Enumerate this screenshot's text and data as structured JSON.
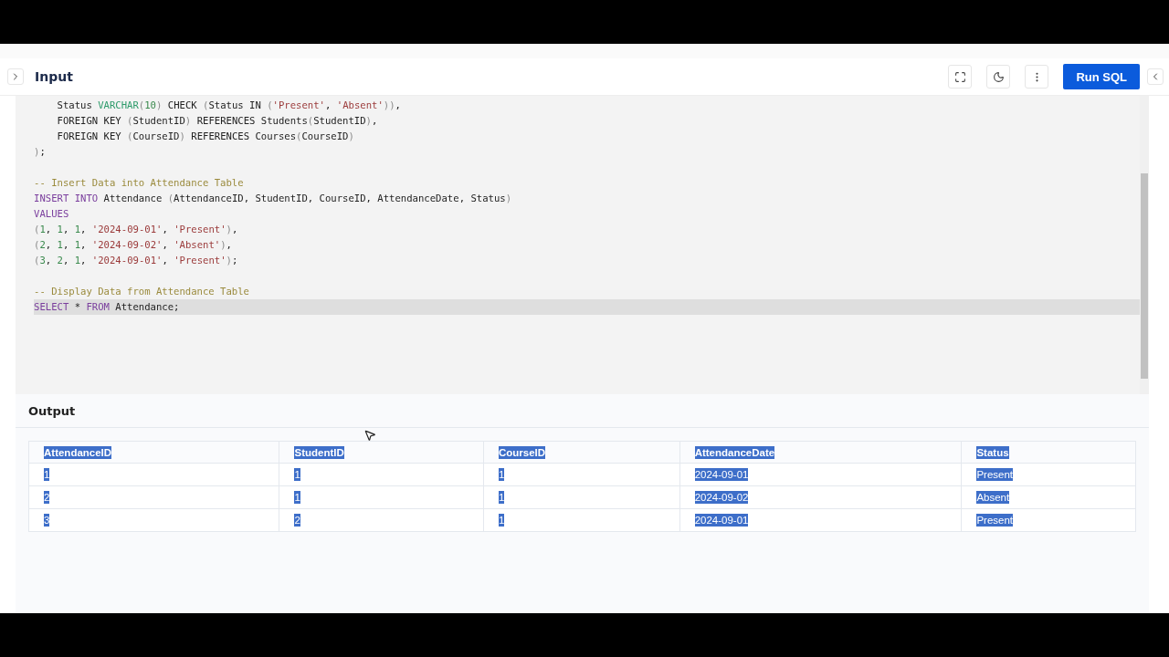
{
  "input": {
    "title": "Input",
    "run_button": "Run SQL",
    "code_lines": [
      {
        "highlighted": false,
        "tokens": [
          {
            "kind": "plain",
            "text": "    Status "
          },
          {
            "kind": "type",
            "text": "VARCHAR"
          },
          {
            "kind": "punct",
            "text": "("
          },
          {
            "kind": "num",
            "text": "10"
          },
          {
            "kind": "punct",
            "text": ")"
          },
          {
            "kind": "plain",
            "text": " CHECK "
          },
          {
            "kind": "punct",
            "text": "("
          },
          {
            "kind": "plain",
            "text": "Status IN "
          },
          {
            "kind": "punct",
            "text": "("
          },
          {
            "kind": "str",
            "text": "'Present'"
          },
          {
            "kind": "plain",
            "text": ", "
          },
          {
            "kind": "str",
            "text": "'Absent'"
          },
          {
            "kind": "punct",
            "text": "))"
          },
          {
            "kind": "plain",
            "text": ","
          }
        ]
      },
      {
        "highlighted": false,
        "tokens": [
          {
            "kind": "plain",
            "text": "    FOREIGN KEY "
          },
          {
            "kind": "punct",
            "text": "("
          },
          {
            "kind": "plain",
            "text": "StudentID"
          },
          {
            "kind": "punct",
            "text": ")"
          },
          {
            "kind": "plain",
            "text": " REFERENCES Students"
          },
          {
            "kind": "punct",
            "text": "("
          },
          {
            "kind": "plain",
            "text": "StudentID"
          },
          {
            "kind": "punct",
            "text": ")"
          },
          {
            "kind": "plain",
            "text": ","
          }
        ]
      },
      {
        "highlighted": false,
        "tokens": [
          {
            "kind": "plain",
            "text": "    FOREIGN KEY "
          },
          {
            "kind": "punct",
            "text": "("
          },
          {
            "kind": "plain",
            "text": "CourseID"
          },
          {
            "kind": "punct",
            "text": ")"
          },
          {
            "kind": "plain",
            "text": " REFERENCES Courses"
          },
          {
            "kind": "punct",
            "text": "("
          },
          {
            "kind": "plain",
            "text": "CourseID"
          },
          {
            "kind": "punct",
            "text": ")"
          }
        ]
      },
      {
        "highlighted": false,
        "tokens": [
          {
            "kind": "punct",
            "text": ")"
          },
          {
            "kind": "plain",
            "text": ";"
          }
        ]
      },
      {
        "highlighted": false
      },
      {
        "highlighted": false,
        "tokens": [
          {
            "kind": "comment",
            "text": "-- Insert Data into Attendance Table"
          }
        ]
      },
      {
        "highlighted": false,
        "tokens": [
          {
            "kind": "kw",
            "text": "INSERT INTO"
          },
          {
            "kind": "plain",
            "text": " Attendance "
          },
          {
            "kind": "punct",
            "text": "("
          },
          {
            "kind": "plain",
            "text": "AttendanceID, StudentID, CourseID, AttendanceDate, Status"
          },
          {
            "kind": "punct",
            "text": ")"
          }
        ]
      },
      {
        "highlighted": false,
        "tokens": [
          {
            "kind": "kw",
            "text": "VALUES"
          }
        ]
      },
      {
        "highlighted": false,
        "tokens": [
          {
            "kind": "punct",
            "text": "("
          },
          {
            "kind": "num",
            "text": "1"
          },
          {
            "kind": "plain",
            "text": ", "
          },
          {
            "kind": "num",
            "text": "1"
          },
          {
            "kind": "plain",
            "text": ", "
          },
          {
            "kind": "num",
            "text": "1"
          },
          {
            "kind": "plain",
            "text": ", "
          },
          {
            "kind": "str",
            "text": "'2024-09-01'"
          },
          {
            "kind": "plain",
            "text": ", "
          },
          {
            "kind": "str",
            "text": "'Present'"
          },
          {
            "kind": "punct",
            "text": ")"
          },
          {
            "kind": "plain",
            "text": ","
          }
        ]
      },
      {
        "highlighted": false,
        "tokens": [
          {
            "kind": "punct",
            "text": "("
          },
          {
            "kind": "num",
            "text": "2"
          },
          {
            "kind": "plain",
            "text": ", "
          },
          {
            "kind": "num",
            "text": "1"
          },
          {
            "kind": "plain",
            "text": ", "
          },
          {
            "kind": "num",
            "text": "1"
          },
          {
            "kind": "plain",
            "text": ", "
          },
          {
            "kind": "str",
            "text": "'2024-09-02'"
          },
          {
            "kind": "plain",
            "text": ", "
          },
          {
            "kind": "str",
            "text": "'Absent'"
          },
          {
            "kind": "punct",
            "text": ")"
          },
          {
            "kind": "plain",
            "text": ","
          }
        ]
      },
      {
        "highlighted": false,
        "tokens": [
          {
            "kind": "punct",
            "text": "("
          },
          {
            "kind": "num",
            "text": "3"
          },
          {
            "kind": "plain",
            "text": ", "
          },
          {
            "kind": "num",
            "text": "2"
          },
          {
            "kind": "plain",
            "text": ", "
          },
          {
            "kind": "num",
            "text": "1"
          },
          {
            "kind": "plain",
            "text": ", "
          },
          {
            "kind": "str",
            "text": "'2024-09-01'"
          },
          {
            "kind": "plain",
            "text": ", "
          },
          {
            "kind": "str",
            "text": "'Present'"
          },
          {
            "kind": "punct",
            "text": ")"
          },
          {
            "kind": "plain",
            "text": ";"
          }
        ]
      },
      {
        "highlighted": false
      },
      {
        "highlighted": false,
        "tokens": [
          {
            "kind": "comment",
            "text": "-- Display Data from Attendance Table"
          }
        ]
      },
      {
        "highlighted": true,
        "tokens": [
          {
            "kind": "kw",
            "text": "SELECT"
          },
          {
            "kind": "plain",
            "text": " * "
          },
          {
            "kind": "kw",
            "text": "FROM"
          },
          {
            "kind": "plain",
            "text": " Attendance;"
          }
        ]
      }
    ]
  },
  "output": {
    "title": "Output",
    "text_selected": true,
    "columns": [
      "AttendanceID",
      "StudentID",
      "CourseID",
      "AttendanceDate",
      "Status"
    ],
    "rows": [
      [
        "1",
        "1",
        "1",
        "2024-09-01",
        "Present"
      ],
      [
        "2",
        "1",
        "1",
        "2024-09-02",
        "Absent"
      ],
      [
        "3",
        "2",
        "1",
        "2024-09-01",
        "Present"
      ]
    ]
  }
}
